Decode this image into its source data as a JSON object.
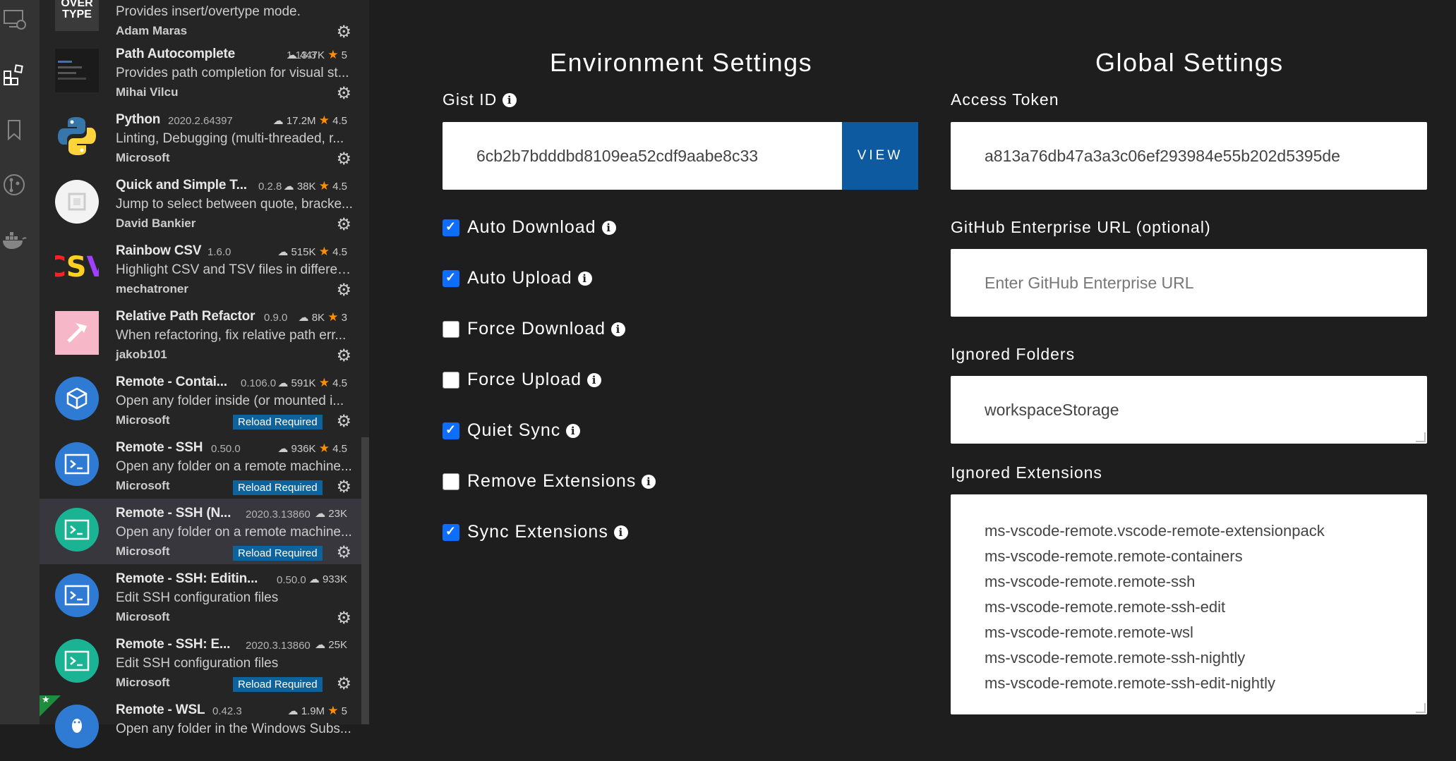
{
  "activity_bar": {
    "icons": [
      "remote-explorer-icon",
      "extensions-icon",
      "bookmarks-icon",
      "source-control-icon",
      "docker-icon"
    ]
  },
  "extensions": [
    {
      "name": "",
      "version": "",
      "downloads": "",
      "rating": "",
      "description": "Provides insert/overtype mode.",
      "publisher": "Adam Maras",
      "reload": false,
      "icon_text": "OVER TYPE"
    },
    {
      "name": "Path Autocomplete",
      "version": "1.13.3",
      "downloads": "447K",
      "rating": "5",
      "description": "Provides path completion for visual st...",
      "publisher": "Mihai Vilcu",
      "reload": false
    },
    {
      "name": "Python",
      "version": "2020.2.64397",
      "downloads": "17.2M",
      "rating": "4.5",
      "description": "Linting, Debugging (multi-threaded, r...",
      "publisher": "Microsoft",
      "reload": false
    },
    {
      "name": "Quick and Simple T...",
      "version": "0.2.8",
      "downloads": "38K",
      "rating": "4.5",
      "description": "Jump to select between quote, bracke...",
      "publisher": "David Bankier",
      "reload": false
    },
    {
      "name": "Rainbow CSV",
      "version": "1.6.0",
      "downloads": "515K",
      "rating": "4.5",
      "description": "Highlight CSV and TSV files in differen...",
      "publisher": "mechatroner",
      "reload": false,
      "icon_text": "CSV"
    },
    {
      "name": "Relative Path Refactor",
      "version": "0.9.0",
      "downloads": "8K",
      "rating": "3",
      "description": "When refactoring, fix relative path err...",
      "publisher": "jakob101",
      "reload": false
    },
    {
      "name": "Remote - Contai...",
      "version": "0.106.0",
      "downloads": "591K",
      "rating": "4.5",
      "description": "Open any folder inside (or mounted i...",
      "publisher": "Microsoft",
      "reload": true
    },
    {
      "name": "Remote - SSH",
      "version": "0.50.0",
      "downloads": "936K",
      "rating": "4.5",
      "description": "Open any folder on a remote machine...",
      "publisher": "Microsoft",
      "reload": true
    },
    {
      "name": "Remote - SSH (N...",
      "version": "2020.3.13860",
      "downloads": "23K",
      "rating": "",
      "description": "Open any folder on a remote machine...",
      "publisher": "Microsoft",
      "reload": true,
      "selected": true
    },
    {
      "name": "Remote - SSH: Editin...",
      "version": "0.50.0",
      "downloads": "933K",
      "rating": "",
      "description": "Edit SSH configuration files",
      "publisher": "Microsoft",
      "reload": false
    },
    {
      "name": "Remote - SSH: E...",
      "version": "2020.3.13860",
      "downloads": "25K",
      "rating": "",
      "description": "Edit SSH configuration files",
      "publisher": "Microsoft",
      "reload": true
    },
    {
      "name": "Remote - WSL",
      "version": "0.42.3",
      "downloads": "1.9M",
      "rating": "5",
      "description": "Open any folder in the Windows Subs...",
      "publisher": "",
      "reload": false
    }
  ],
  "reload_label": "Reload Required",
  "settings": {
    "env_title": "Environment Settings",
    "global_title": "Global Settings",
    "gist_label": "Gist ID",
    "gist_value": "6cb2b7bdddbd8109ea52cdf9aabe8c33",
    "view_label": "VIEW",
    "token_label": "Access Token",
    "token_value": "a813a76db47a3a3c06ef293984e55b202d5395de",
    "enterprise_label": "GitHub Enterprise URL (optional)",
    "enterprise_placeholder": "Enter GitHub Enterprise URL",
    "folders_label": "Ignored Folders",
    "folders_value": "workspaceStorage",
    "extensions_label": "Ignored Extensions",
    "ignored_extensions": [
      "ms-vscode-remote.vscode-remote-extensionpack",
      "ms-vscode-remote.remote-containers",
      "ms-vscode-remote.remote-ssh",
      "ms-vscode-remote.remote-ssh-edit",
      "ms-vscode-remote.remote-wsl",
      "ms-vscode-remote.remote-ssh-nightly",
      "ms-vscode-remote.remote-ssh-edit-nightly"
    ],
    "checkboxes": [
      {
        "label": "Auto Download",
        "checked": true
      },
      {
        "label": "Auto Upload",
        "checked": true
      },
      {
        "label": "Force Download",
        "checked": false
      },
      {
        "label": "Force Upload",
        "checked": false
      },
      {
        "label": "Quiet Sync",
        "checked": true
      },
      {
        "label": "Remove Extensions",
        "checked": false
      },
      {
        "label": "Sync Extensions",
        "checked": true
      }
    ]
  },
  "colors": {
    "accent": "#0e639c",
    "star": "#ff8e00",
    "checkbox": "#0d6efd"
  }
}
